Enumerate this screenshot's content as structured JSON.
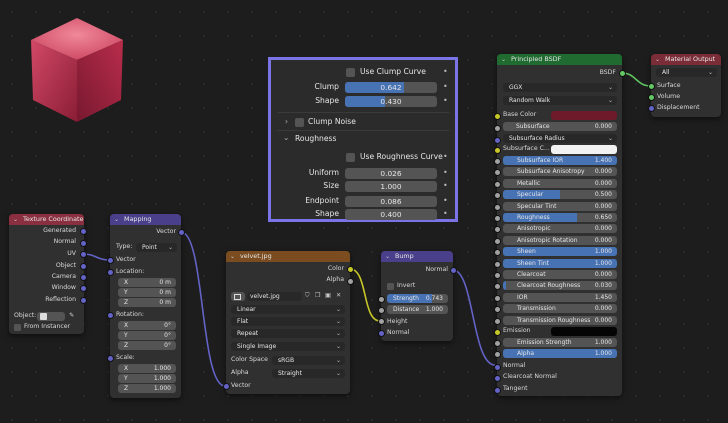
{
  "colors": {
    "texcoord_header": "#8a2f3f",
    "mapping_header": "#493f8b",
    "image_header": "#7a4c1f",
    "bump_header": "#493f8b",
    "bsdf_header": "#1f6b30",
    "output_header": "#7a2c37",
    "base_color": "#6e1a2a",
    "socket_vector": "#6363c7",
    "socket_color": "#c7c729",
    "socket_float": "#a1a1a1",
    "socket_shader": "#63c763",
    "overlay_border": "#7b74e6"
  },
  "overlay": {
    "use_clump_curve": "Use Clump Curve",
    "clump_label": "Clump",
    "clump_value": "0.642",
    "clump_fraction": 0.642,
    "shape_label": "Shape",
    "shape_value": "0.430",
    "shape_fraction": 0.43,
    "clump_noise": "Clump Noise",
    "roughness": "Roughness",
    "use_roughness_curve": "Use Roughness Curve",
    "uniform_label": "Uniform",
    "uniform_value": "0.026",
    "size_label": "Size",
    "size_value": "1.000",
    "endpoint_label": "Endpoint",
    "endpoint_value": "0.086",
    "shape2_label": "Shape",
    "shape2_value": "0.400"
  },
  "texcoord": {
    "title": "Texture Coordinate",
    "outputs": [
      "Generated",
      "Normal",
      "UV",
      "Object",
      "Camera",
      "Window",
      "Reflection"
    ],
    "object_label": "Object:",
    "from_instancer": "From Instancer"
  },
  "mapping": {
    "title": "Mapping",
    "output": "Vector",
    "type_label": "Type:",
    "type_value": "Point",
    "input_vector": "Vector",
    "location_label": "Location:",
    "location": [
      {
        "axis": "X",
        "value": "0 m"
      },
      {
        "axis": "Y",
        "value": "0 m"
      },
      {
        "axis": "Z",
        "value": "0 m"
      }
    ],
    "rotation_label": "Rotation:",
    "rotation": [
      {
        "axis": "X",
        "value": "0°"
      },
      {
        "axis": "Y",
        "value": "0°"
      },
      {
        "axis": "Z",
        "value": "0°"
      }
    ],
    "scale_label": "Scale:",
    "scale": [
      {
        "axis": "X",
        "value": "1.000"
      },
      {
        "axis": "Y",
        "value": "1.000"
      },
      {
        "axis": "Z",
        "value": "1.000"
      }
    ]
  },
  "image": {
    "title": "velvet.jpg",
    "out_color": "Color",
    "out_alpha": "Alpha",
    "filename": "velvet.jpg",
    "interpolation": "Linear",
    "projection": "Flat",
    "extension": "Repeat",
    "source": "Single Image",
    "colorspace_label": "Color Space",
    "colorspace_value": "sRGB",
    "alpha_label": "Alpha",
    "alpha_value": "Straight",
    "in_vector": "Vector"
  },
  "bump": {
    "title": "Bump",
    "out_normal": "Normal",
    "invert": "Invert",
    "strength_label": "Strength",
    "strength_value": "0.743",
    "strength_fraction": 0.743,
    "distance_label": "Distance",
    "distance_value": "1.000",
    "in_height": "Height",
    "in_normal": "Normal"
  },
  "bsdf": {
    "title": "Principled BSDF",
    "out": "BSDF",
    "distribution": "GGX",
    "subsurface_method": "Random Walk",
    "base_color": "Base Color",
    "subsurface": "Subsurface",
    "subsurface_value": "0.000",
    "subsurface_radius": "Subsurface Radius",
    "subsurface_color": "Subsurface C...",
    "params": [
      {
        "label": "Subsurface IOR",
        "value": "1.400",
        "fill": 1.0
      },
      {
        "label": "Subsurface Anisotropy",
        "value": "0.000",
        "fill": 0
      },
      {
        "label": "Metallic",
        "value": "0.000",
        "fill": 0
      },
      {
        "label": "Specular",
        "value": "0.500",
        "fill": 0.5
      },
      {
        "label": "Specular Tint",
        "value": "0.000",
        "fill": 0
      },
      {
        "label": "Roughness",
        "value": "0.650",
        "fill": 0.65
      },
      {
        "label": "Anisotropic",
        "value": "0.000",
        "fill": 0
      },
      {
        "label": "Anisotropic Rotation",
        "value": "0.000",
        "fill": 0
      },
      {
        "label": "Sheen",
        "value": "1.000",
        "fill": 1.0
      },
      {
        "label": "Sheen Tint",
        "value": "1.000",
        "fill": 1.0
      },
      {
        "label": "Clearcoat",
        "value": "0.000",
        "fill": 0
      },
      {
        "label": "Clearcoat Roughness",
        "value": "0.030",
        "fill": 0.03
      },
      {
        "label": "IOR",
        "value": "1.450",
        "fill": 0
      },
      {
        "label": "Transmission",
        "value": "0.000",
        "fill": 0
      },
      {
        "label": "Transmission Roughness",
        "value": "0.000",
        "fill": 0
      }
    ],
    "emission": "Emission",
    "emission_strength": "Emission Strength",
    "emission_strength_value": "1.000",
    "alpha": "Alpha",
    "alpha_value": "1.000",
    "normal": "Normal",
    "clearcoat_normal": "Clearcoat Normal",
    "tangent": "Tangent"
  },
  "output": {
    "title": "Material Output",
    "target": "All",
    "surface": "Surface",
    "volume": "Volume",
    "displacement": "Displacement"
  }
}
